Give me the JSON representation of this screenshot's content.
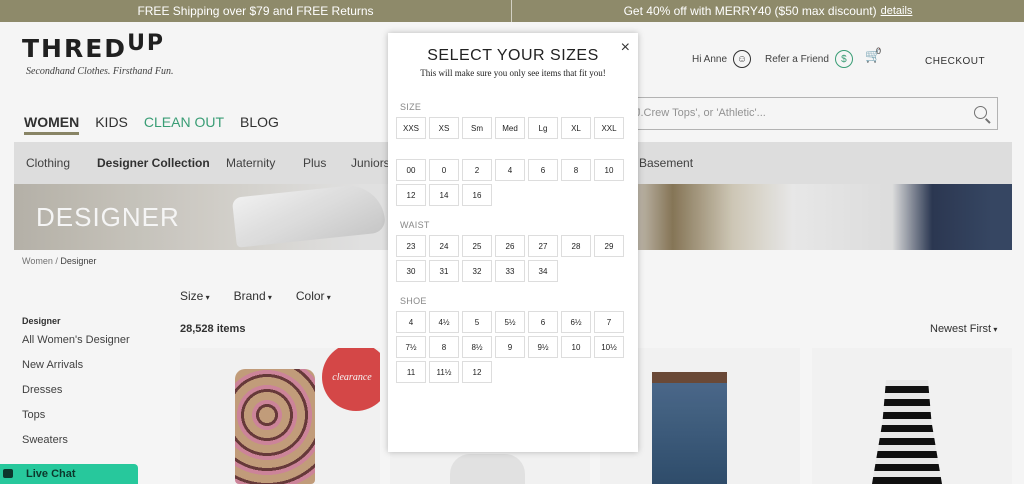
{
  "promo": {
    "left": "FREE Shipping over $79 and FREE Returns",
    "right": "Get 40% off with MERRY40 ($50 max discount)",
    "details_link": "details"
  },
  "brand": {
    "logo_text": "THRED",
    "logo_up": "UP",
    "tagline": "Secondhand Clothes. Firsthand Fun."
  },
  "main_nav": [
    "WOMEN",
    "KIDS",
    "CLEAN OUT",
    "BLOG"
  ],
  "account": {
    "greeting": "Hi Anne",
    "refer": "Refer a Friend",
    "cart_count": "0",
    "checkout": "CHECKOUT"
  },
  "search": {
    "placeholder": "J.Crew Tops', or 'Athletic'..."
  },
  "sub_nav": {
    "clothing": "Clothing",
    "designer": "Designer Collection",
    "maternity": "Maternity",
    "plus": "Plus",
    "juniors": "Juniors",
    "basement": "Basement"
  },
  "banner": {
    "title": "DESIGNER"
  },
  "breadcrumb": {
    "root": "Women",
    "sep": " / ",
    "current": "Designer"
  },
  "filters": [
    "Size",
    "Brand",
    "Color"
  ],
  "sidebar": {
    "heading": "Designer",
    "items": [
      "All Women's Designer",
      "New Arrivals",
      "Dresses",
      "Tops",
      "Sweaters"
    ]
  },
  "results": {
    "count": "28,528 items",
    "sort": "Newest First"
  },
  "product_badge": "clearance",
  "live_chat": "Live Chat",
  "modal": {
    "title": "SELECT YOUR SIZES",
    "subtitle": "This will make sure you only see items that fit you!",
    "close": "×",
    "size_label": "SIZE",
    "sizes_letter": [
      "XXS",
      "XS",
      "Sm",
      "Med",
      "Lg",
      "XL",
      "XXL"
    ],
    "sizes_number": [
      "00",
      "0",
      "2",
      "4",
      "6",
      "8",
      "10",
      "12",
      "14",
      "16"
    ],
    "waist_label": "WAIST",
    "waist": [
      "23",
      "24",
      "25",
      "26",
      "27",
      "28",
      "29",
      "30",
      "31",
      "32",
      "33",
      "34"
    ],
    "shoe_label": "SHOE",
    "shoe": [
      "4",
      "4½",
      "5",
      "5½",
      "6",
      "6½",
      "7",
      "7½",
      "8",
      "8½",
      "9",
      "9½",
      "10",
      "10½",
      "11",
      "11½",
      "12"
    ]
  }
}
